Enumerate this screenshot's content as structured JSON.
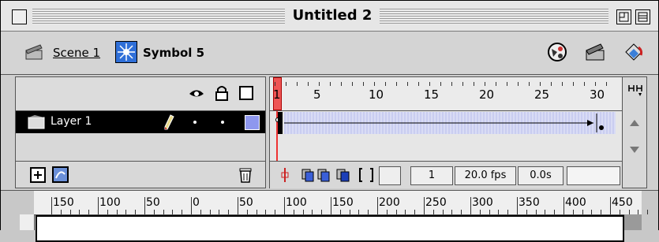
{
  "window": {
    "title": "Untitled 2"
  },
  "scenebar": {
    "scene_label": "Scene 1",
    "symbol_label": "Symbol 5"
  },
  "timeline": {
    "frame_numbers": [
      "1",
      "5",
      "10",
      "15",
      "20",
      "25",
      "30"
    ],
    "layer": {
      "name": "Layer 1",
      "color": "#8e97ee"
    },
    "current_frame": "1",
    "fps": "20.0 fps",
    "elapsed": "0.0s"
  },
  "stage_ruler": [
    "150",
    "100",
    "50",
    "0",
    "50",
    "100",
    "150",
    "200",
    "250",
    "300",
    "350",
    "400",
    "450"
  ],
  "icons": [
    "eye-icon",
    "lock-icon",
    "outline-icon",
    "pencil-icon",
    "add-layer-icon",
    "add-guide-layer-icon",
    "trash-icon",
    "onion-skin-icon",
    "edit-multiple-frames-icon"
  ]
}
